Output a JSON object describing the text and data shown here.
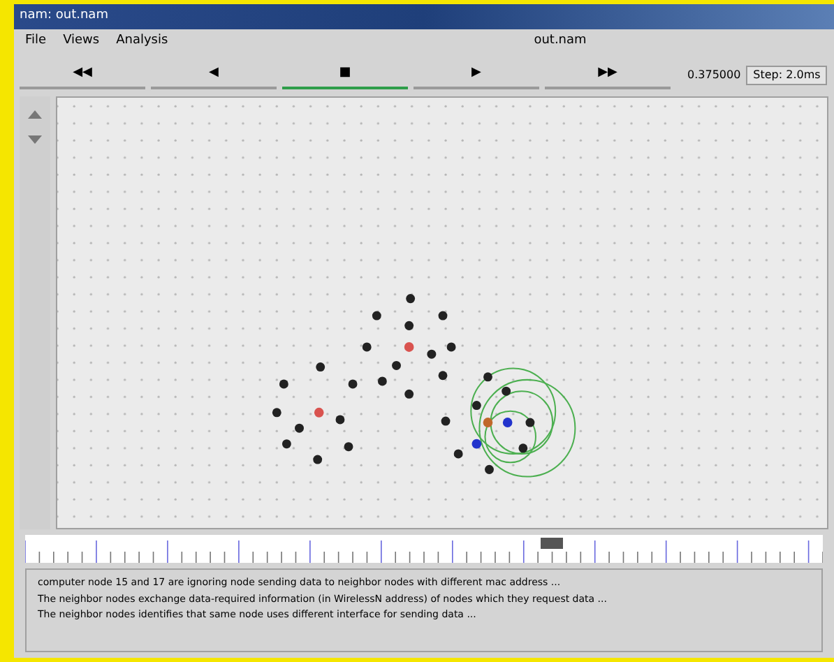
{
  "window": {
    "title": "nam: out.nam"
  },
  "menu": [
    {
      "label": "File"
    },
    {
      "label": "Views"
    },
    {
      "label": "Analysis"
    }
  ],
  "file_name": "out.nam",
  "playback": [
    {
      "symbol": "◀◀",
      "selected": false
    },
    {
      "symbol": "◀",
      "selected": false
    },
    {
      "symbol": "■",
      "selected": true
    },
    {
      "symbol": "▶",
      "selected": false
    },
    {
      "symbol": "▶▶",
      "selected": false
    }
  ],
  "time": "0.375000",
  "step": "Step: 2.0ms",
  "timeline": {
    "level": 0.66
  },
  "log": [
    "computer node 15 and 17 are ignoring node sending data to neighbor nodes with different mac address ...",
    "The neighbor nodes exchange data-required information (in WirelessN address) of nodes which they request data ...",
    "The neighbor nodes identifies that same node uses different interface for sending data ..."
  ]
}
